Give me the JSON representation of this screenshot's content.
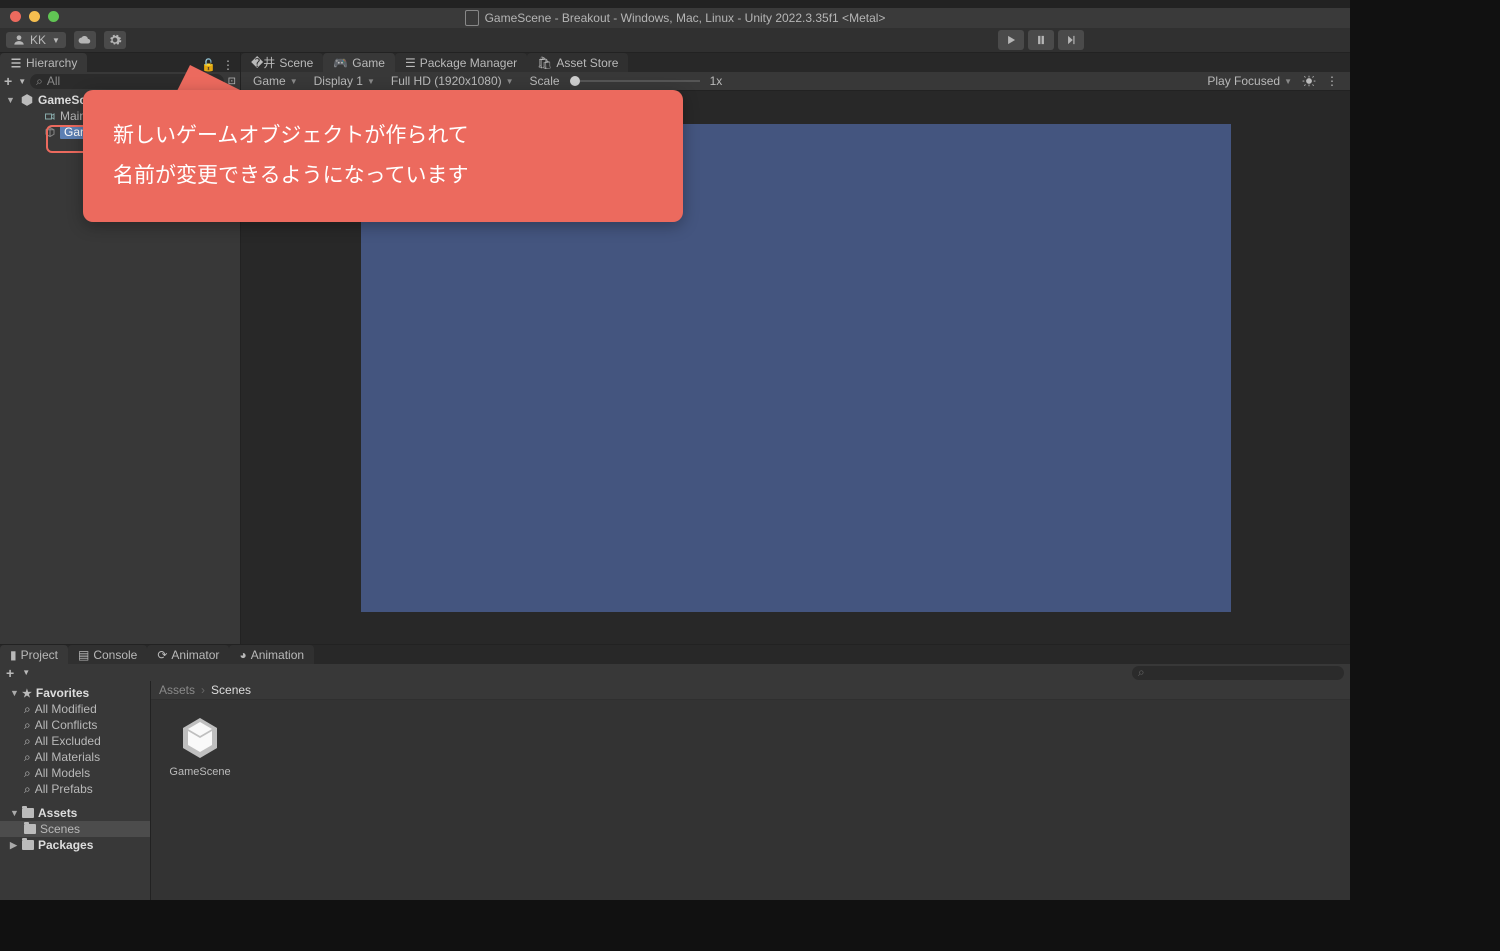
{
  "window_title": "GameScene - Breakout - Windows, Mac, Linux - Unity 2022.3.35f1 <Metal>",
  "account_label": "KK",
  "hierarchy": {
    "tab_label": "Hierarchy",
    "search_placeholder": "All",
    "scene": "GameScene*",
    "items": [
      "Main Camera",
      "GameObject"
    ],
    "editing_value": "GameObject"
  },
  "callout_text": "新しいゲームオブジェクトが作られて\n名前が変更できるようになっています",
  "view_tabs": {
    "scene": "Scene",
    "game": "Game",
    "package_manager": "Package Manager",
    "asset_store": "Asset Store"
  },
  "game_toolbar": {
    "mode": "Game",
    "display": "Display 1",
    "resolution": "Full HD (1920x1080)",
    "scale_label": "Scale",
    "scale_value": "1x",
    "play_focused": "Play Focused"
  },
  "project_panel": {
    "tabs": {
      "project": "Project",
      "console": "Console",
      "animator": "Animator",
      "animation": "Animation"
    },
    "favorites_label": "Favorites",
    "favorites": [
      "All Modified",
      "All Conflicts",
      "All Excluded",
      "All Materials",
      "All Models",
      "All Prefabs"
    ],
    "assets_label": "Assets",
    "assets_children": [
      "Scenes"
    ],
    "packages_label": "Packages",
    "breadcrumb": [
      "Assets",
      "Scenes"
    ],
    "grid_items": [
      {
        "name": "GameScene"
      }
    ]
  }
}
